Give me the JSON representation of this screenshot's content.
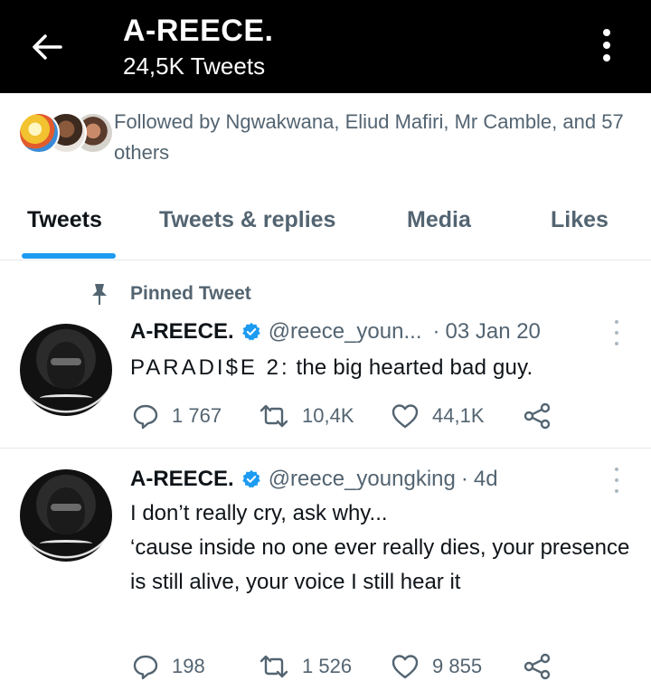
{
  "header": {
    "title": "A-REECE.",
    "subtitle": "24,5K Tweets"
  },
  "followed_by": {
    "text": "Followed by Ngwakwana, Eliud Mafiri, Mr Camble, and 57 others"
  },
  "tabs": [
    {
      "label": "Tweets",
      "active": true
    },
    {
      "label": "Tweets & replies",
      "active": false
    },
    {
      "label": "Media",
      "active": false
    },
    {
      "label": "Likes",
      "active": false
    }
  ],
  "colors": {
    "accent": "#1d9bf0",
    "header_bg": "#000000",
    "muted_text": "#536471"
  },
  "tweets": [
    {
      "pinned_label": "Pinned Tweet",
      "name": "A-REECE.",
      "handle": "@reece_youn...",
      "separator": "·",
      "time": "03 Jan 20",
      "text_prefix": "PARADI$E 2:",
      "text_rest": " the big hearted bad guy.",
      "replies": "1 767",
      "retweets": "10,4K",
      "likes": "44,1K"
    },
    {
      "name": "A-REECE.",
      "handle": "@reece_youngking",
      "separator": "·",
      "time": "4d",
      "line1": "I don’t really cry, ask why...",
      "line2": "‘cause inside no one ever really dies, your presence is still alive, your voice I still hear it",
      "replies": "198",
      "retweets": "1 526",
      "likes": "9 855"
    }
  ]
}
